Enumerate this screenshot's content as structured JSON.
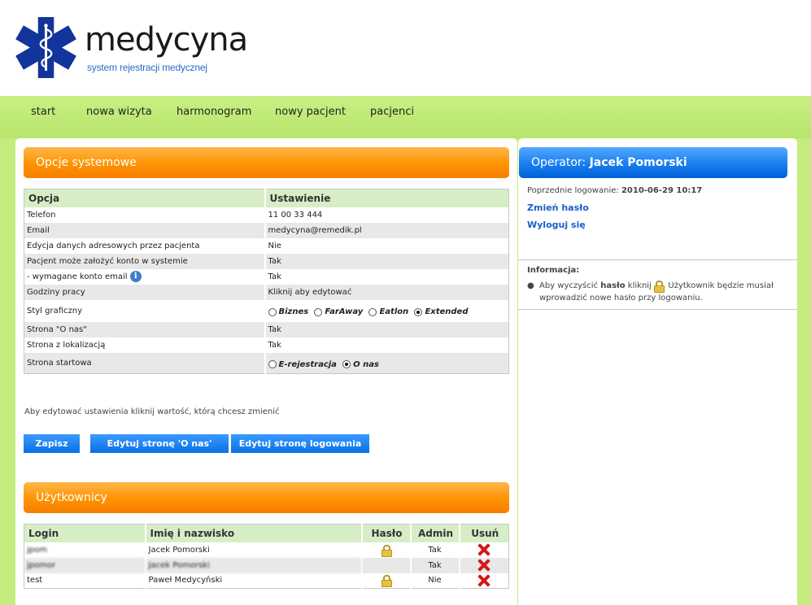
{
  "brand": {
    "title": "medycyna",
    "subtitle": "system rejestracji medycznej"
  },
  "nav": [
    "start",
    "nowa wizyta",
    "harmonogram",
    "nowy pacjent",
    "pacjenci"
  ],
  "options": {
    "title": "Opcje systemowe",
    "col_option": "Opcja",
    "col_setting": "Ustawienie",
    "rows": [
      {
        "label": "Telefon",
        "value": "11 00 33 444"
      },
      {
        "label": "Email",
        "value": "medycyna@remedik.pl"
      },
      {
        "label": "Edycja danych adresowych przez pacjenta",
        "value": "Nie"
      },
      {
        "label": "Pacjent może założyć konto w systemie",
        "value": "Tak"
      },
      {
        "label": " - wymagane konto email",
        "value": "Tak"
      },
      {
        "label": "Godziny pracy",
        "value": "Kliknij aby edytować"
      },
      {
        "label": "Styl graficzny",
        "value": ""
      },
      {
        "label": "Strona \"O nas\"",
        "value": "Tak"
      },
      {
        "label": "Strona z lokalizacją",
        "value": "Tak"
      },
      {
        "label": "Strona startowa",
        "value": ""
      }
    ],
    "style_choices": [
      "Biznes",
      "FarAway",
      "Eatlon",
      "Extended"
    ],
    "style_selected": "Extended",
    "start_choices": [
      "E-rejestracja",
      "O nas"
    ],
    "start_selected": "O nas",
    "hint": "Aby edytować ustawienia kliknij wartość, którą chcesz zmienić",
    "buttons": {
      "save": "Zapisz",
      "edit_about": "Edytuj stronę 'O nas'",
      "edit_login": "Edytuj stronę logowania"
    }
  },
  "users": {
    "title": "Użytkownicy",
    "cols": [
      "Login",
      "Imię i nazwisko",
      "Hasło",
      "Admin",
      "Usuń"
    ],
    "rows": [
      {
        "login": "jpom",
        "name": "Jacek Pomorski",
        "lock": true,
        "admin": "Tak"
      },
      {
        "login": "jpomor",
        "name": "Jacek Pomorski",
        "lock": false,
        "admin": "Tak"
      },
      {
        "login": "test",
        "name": "Paweł Medycyński",
        "lock": true,
        "admin": "Nie"
      }
    ]
  },
  "operator": {
    "label": "Operator:",
    "name": "Jacek Pomorski",
    "last_login_label": "Poprzednie logowanie:",
    "last_login": "2010-06-29 10:17",
    "change_password": "Zmień hasło",
    "logout": "Wyloguj się",
    "info_title": "Informacja:",
    "info_1": "Aby wyczyścić ",
    "info_bold": "hasło",
    "info_2": " kliknij ",
    "info_3": ". Użytkownik będzie musiał wprowadzić nowe hasło przy logowaniu."
  },
  "colors": {
    "accent_orange": "#ff9300",
    "accent_blue": "#1a7ef0",
    "nav_green": "#c5ec7e"
  }
}
